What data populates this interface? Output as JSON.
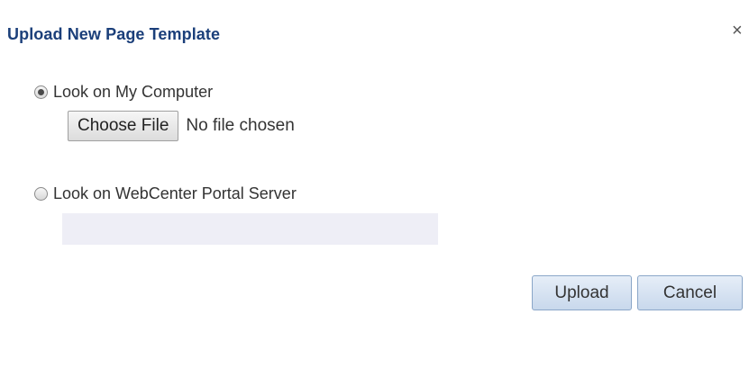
{
  "dialog": {
    "title": "Upload New Page Template",
    "close_glyph": "×",
    "close_icon": "close-icon"
  },
  "source_options": [
    {
      "label": "Look on My Computer",
      "selected": true
    },
    {
      "label": "Look on WebCenter Portal Server",
      "selected": false
    }
  ],
  "file_picker": {
    "button_label": "Choose File",
    "status_text": "No file chosen"
  },
  "server_path": {
    "value": "",
    "disabled": true
  },
  "actions": {
    "upload_label": "Upload",
    "cancel_label": "Cancel"
  },
  "colors": {
    "title": "#1b3f7a",
    "button_fill": "#c8d8ec",
    "button_border": "#8aa6c8",
    "disabled_input": "#eeeef6"
  }
}
